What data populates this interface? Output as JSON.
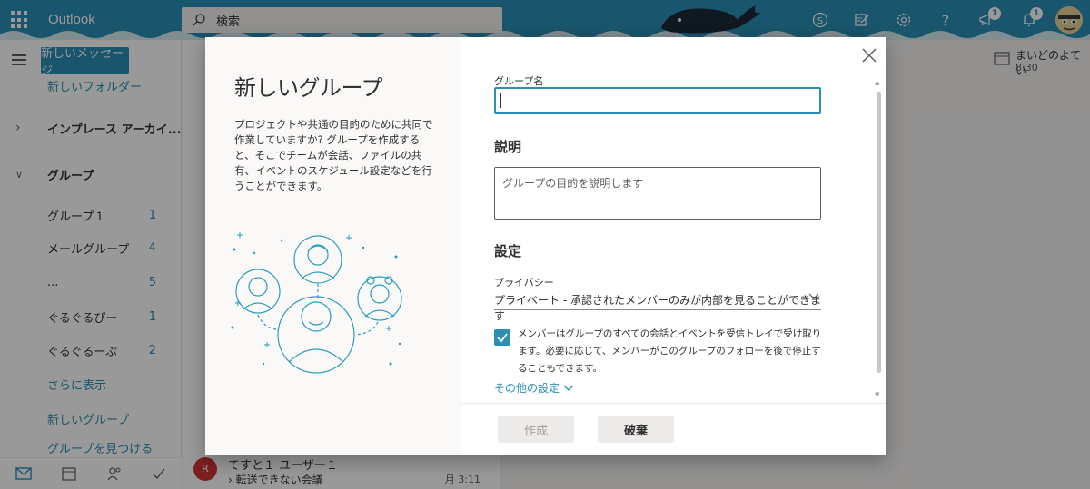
{
  "app": {
    "name": "Outlook"
  },
  "search": {
    "placeholder": "検索"
  },
  "header": {
    "badges": {
      "megaphone": "1",
      "bell": "1"
    }
  },
  "sidebar": {
    "new_message": "新しいメッセージ",
    "new_folder": "新しいフォルダー",
    "archive": "インプレース アーカイ...",
    "groups_header": "グループ",
    "groups": [
      {
        "label": "グループ１",
        "count": "1"
      },
      {
        "label": "メールグループ",
        "count": "4"
      },
      {
        "label": "...",
        "count": "5"
      },
      {
        "label": "ぐるぐるぴー",
        "count": "1"
      },
      {
        "label": "ぐるぐるーぷ",
        "count": "2"
      }
    ],
    "show_more": "さらに表示",
    "new_group": "新しいグループ",
    "partial_item": "グループを見つける"
  },
  "message_list": {
    "item": {
      "avatar": "R",
      "from": "てすと１ ユーザー１",
      "subject": "転送できない会議",
      "time": "月 3:11"
    }
  },
  "reminder": {
    "title": "まいどのよてい",
    "time": "8:30"
  },
  "dialog": {
    "title": "新しいグループ",
    "description": "プロジェクトや共通の目的のために共同で作業していますか? グループを作成すると、そこでチームが会話、ファイルの共有、イベントのスケジュール設定などを行うことができます。",
    "name_label": "グループ名",
    "name_value": "",
    "description_header": "説明",
    "description_placeholder": "グループの目的を説明します",
    "settings_header": "設定",
    "privacy_label": "プライバシー",
    "privacy_value": "プライベート - 承認されたメンバーのみが内部を見ることができます",
    "subscribe_text": "メンバーはグループのすべての会話とイベントを受信トレイで受け取ります。必要に応じて、メンバーがこのグループのフォローを後で停止することもできます。",
    "subscribe_checked": true,
    "more_settings": "その他の設定",
    "create_button": "作成",
    "discard_button": "破棄"
  },
  "colors": {
    "accent": "#2a8eb5"
  }
}
